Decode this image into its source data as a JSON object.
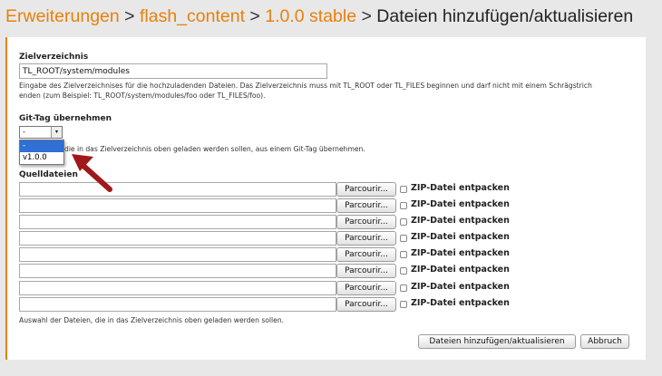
{
  "breadcrumb": {
    "item1": "Erweiterungen",
    "item2": "flash_content",
    "item3": "1.0.0 stable",
    "current": "Dateien hinzufügen/aktualisieren",
    "separator": ">"
  },
  "target": {
    "label": "Zielverzeichnis",
    "value": "TL_ROOT/system/modules",
    "help_line1": "Eingabe des Zielverzeichnises für die hochzuladenden Dateien. Das Zielverzeichnis muss mit TL_ROOT oder TL_FILES beginnen und darf nicht mit einem Schrägstrich",
    "help_line2": "enden (zum Beispiel: TL_ROOT/system/modules/foo oder TL_FILES/foo)."
  },
  "git": {
    "label": "Git-Tag übernehmen",
    "selected": "-",
    "options": [
      "-",
      "v1.0.0"
    ],
    "help": "die in das Zielverzeichnis oben geladen werden sollen, aus einem Git-Tag übernehmen."
  },
  "sources": {
    "label": "Quelldateien",
    "browse_label": "Parcourir...",
    "zip_label": "ZIP-Datei entpacken",
    "rows": [
      1,
      2,
      3,
      4,
      5,
      6,
      7,
      8
    ],
    "help": "Auswahl der Dateien, die in das Zielverzeichnis oben geladen werden sollen."
  },
  "actions": {
    "submit_label": "Dateien hinzufügen/aktualisieren",
    "cancel_label": "Abbruch"
  },
  "colors": {
    "accent": "#e8800c",
    "annotation_arrow": "#a01818"
  }
}
